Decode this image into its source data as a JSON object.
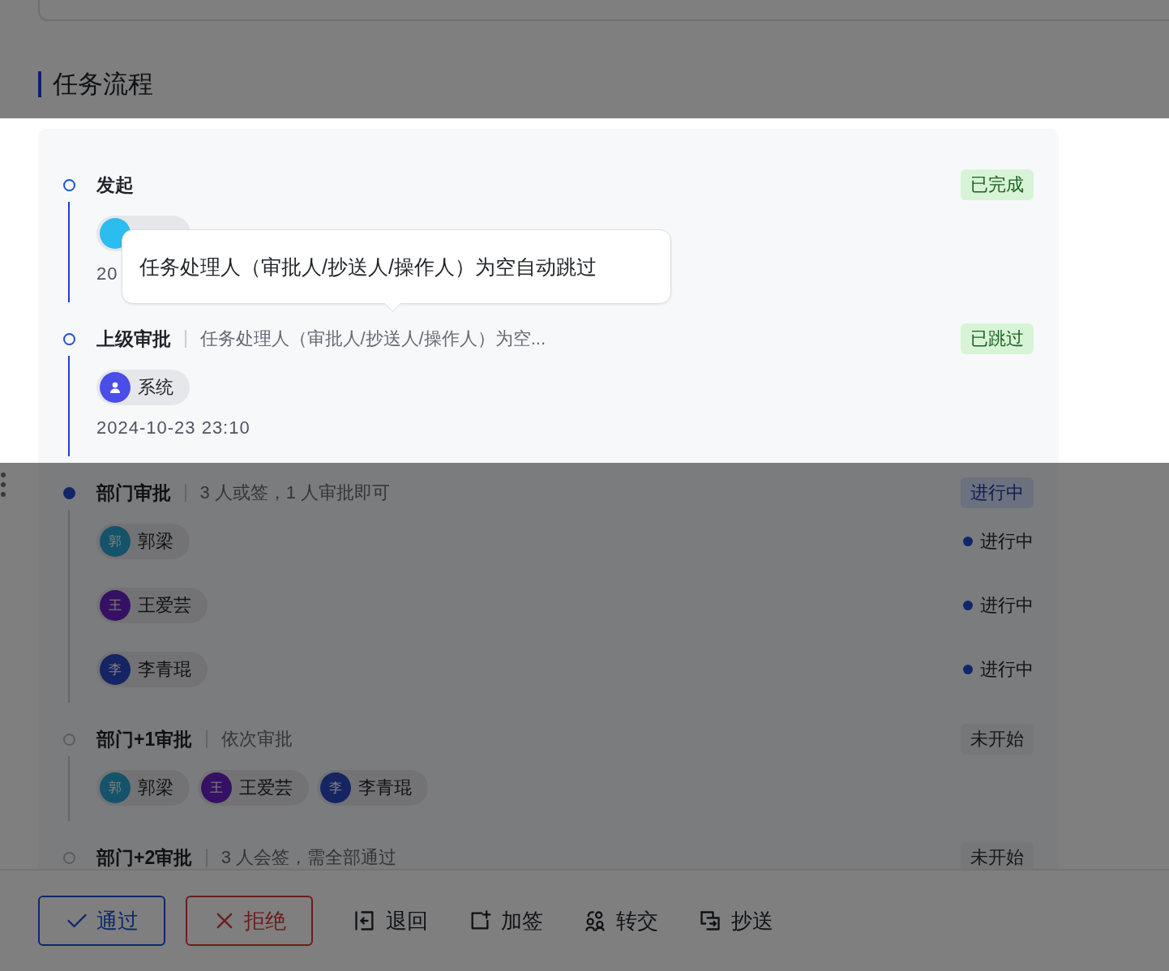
{
  "section": {
    "title": "任务流程"
  },
  "steps": [
    {
      "title": "发起",
      "status": {
        "text": "已完成",
        "kind": "done"
      },
      "people": [
        {
          "avatar": {
            "kind": "initial"
          }
        }
      ],
      "date": "20"
    },
    {
      "title": "上级审批",
      "description": "任务处理人（审批人/抄送人/操作人）为空...",
      "status": {
        "text": "已跳过",
        "kind": "skipped"
      },
      "people": [
        {
          "name": "系统",
          "avatar": {
            "kind": "icon"
          }
        }
      ],
      "date": "2024-10-23 23:10"
    },
    {
      "title": "部门审批",
      "description": "3 人或签，1 人审批即可",
      "status": {
        "text": "进行中",
        "kind": "active"
      },
      "people": [
        {
          "name": "郭梁",
          "avatar": {
            "kind": "initial",
            "text": "郭"
          },
          "state": {
            "text": "进行中",
            "kind": "active"
          }
        },
        {
          "name": "王爱芸",
          "avatar": {
            "kind": "initial",
            "text": "王"
          },
          "state": {
            "text": "进行中",
            "kind": "active"
          }
        },
        {
          "name": "李青琨",
          "avatar": {
            "kind": "initial",
            "text": "李"
          },
          "state": {
            "text": "进行中",
            "kind": "active"
          }
        }
      ]
    },
    {
      "title": "部门+1审批",
      "description": "依次审批",
      "status": {
        "text": "未开始",
        "kind": "pending"
      },
      "people": [
        {
          "name": "郭梁",
          "avatar": {
            "kind": "initial",
            "text": "郭"
          }
        },
        {
          "name": "王爱芸",
          "avatar": {
            "kind": "initial",
            "text": "王"
          }
        },
        {
          "name": "李青琨",
          "avatar": {
            "kind": "initial",
            "text": "李"
          }
        }
      ]
    },
    {
      "title": "部门+2审批",
      "description": "3 人会签，需全部通过",
      "status": {
        "text": "未开始",
        "kind": "pending"
      }
    }
  ],
  "tooltip": {
    "text": "任务处理人（审批人/抄送人/操作人）为空自动跳过"
  },
  "actions": [
    {
      "label": "通过",
      "kind": "approve"
    },
    {
      "label": "拒绝",
      "kind": "reject"
    },
    {
      "label": "退回",
      "kind": "return"
    },
    {
      "label": "加签",
      "kind": "add-signer"
    },
    {
      "label": "转交",
      "kind": "transfer"
    },
    {
      "label": "抄送",
      "kind": "copy"
    }
  ]
}
